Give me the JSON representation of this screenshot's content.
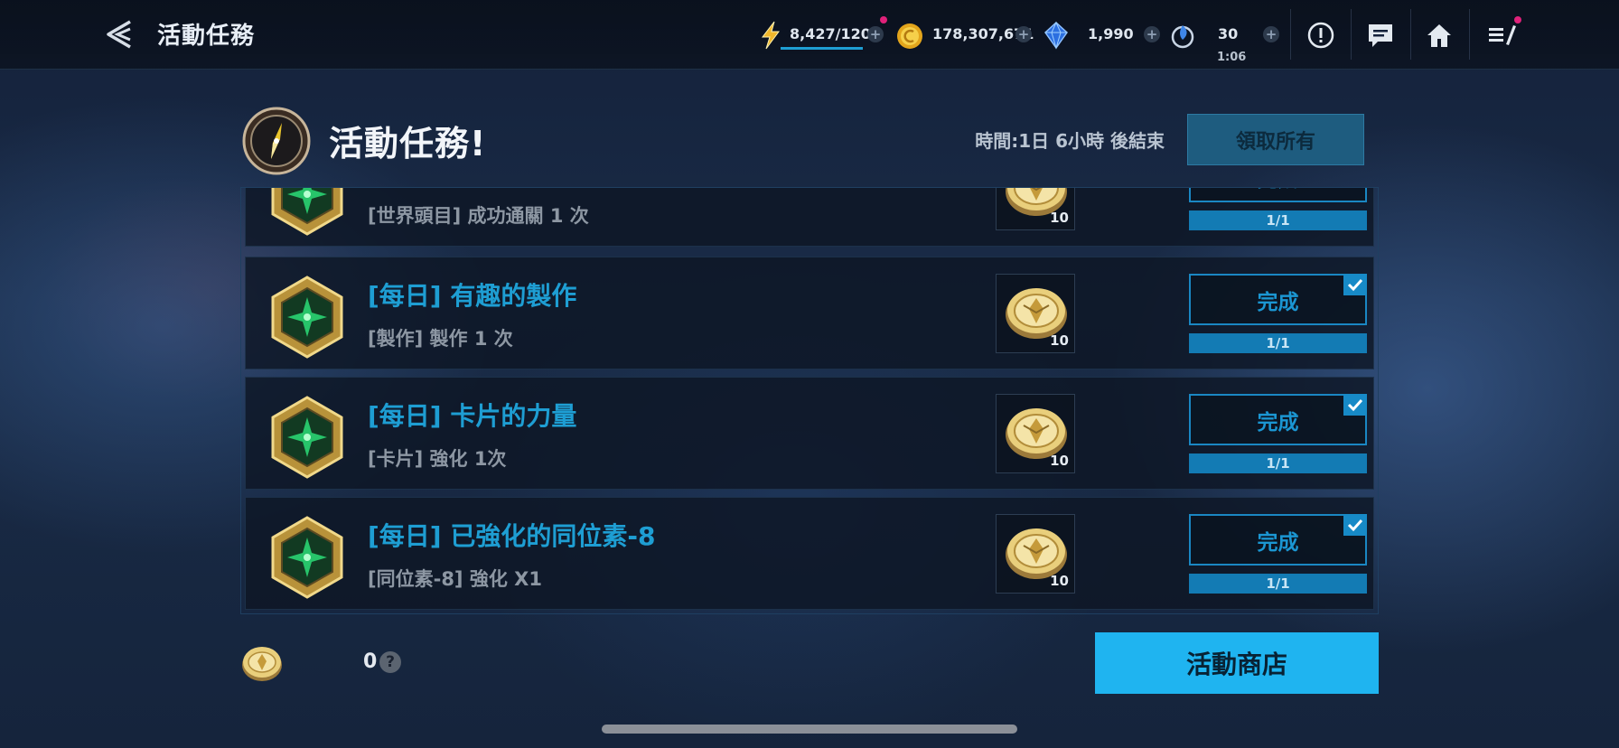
{
  "topbar": {
    "title": "活動任務",
    "energy": "8,427/120",
    "gold": "178,307,671",
    "crystal": "1,990",
    "ticket": "30",
    "ticket_timer": "1:06",
    "icons": [
      "back-arrow-icon",
      "lightning-icon",
      "gold-coin-icon",
      "blue-crystal-icon",
      "flame-ticket-icon",
      "notice-icon",
      "chat-icon",
      "home-icon",
      "quest-log-icon"
    ],
    "colors": {
      "notification_dot": "#e0217a",
      "energy_underline": "#1e9ed3"
    }
  },
  "panel": {
    "title": "活動任務!",
    "timer": "時間:1日 6小時 後結束",
    "claim_all": "領取所有"
  },
  "quests": [
    {
      "name": "",
      "desc": "[世界頭目] 成功通關 1 次",
      "reward": "10",
      "status": "完成",
      "progress": "1/1"
    },
    {
      "name": "[每日] 有趣的製作",
      "desc": "[製作] 製作 1 次",
      "reward": "10",
      "status": "完成",
      "progress": "1/1"
    },
    {
      "name": "[每日] 卡片的力量",
      "desc": "[卡片] 強化 1次",
      "reward": "10",
      "status": "完成",
      "progress": "1/1"
    },
    {
      "name": "[每日] 已強化的同位素-8",
      "desc": "[同位素-8] 強化 X1",
      "reward": "10",
      "status": "完成",
      "progress": "1/1"
    }
  ],
  "footer": {
    "coin_count": "0",
    "help": "?",
    "shop": "活動商店"
  },
  "colors": {
    "accent": "#1e9ed3",
    "progress": "#137bb4",
    "shop_button": "#1fb4f0"
  }
}
